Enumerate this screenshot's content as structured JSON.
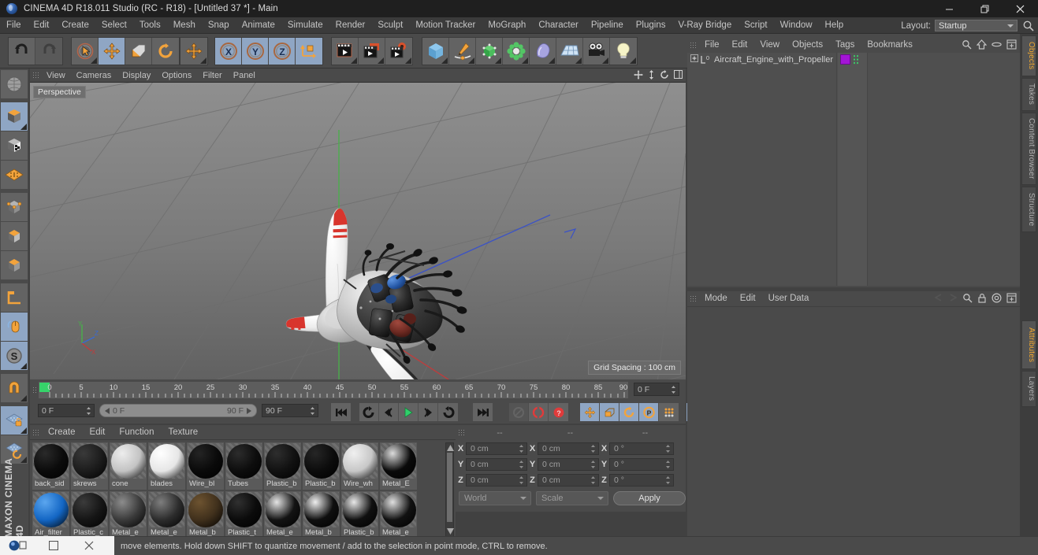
{
  "window": {
    "title": "CINEMA 4D R18.011 Studio (RC - R18) - [Untitled 37 *] - Main",
    "minimize": "minimize-button",
    "maximize": "restore-button",
    "close": "close-button"
  },
  "menubar": {
    "items": [
      "File",
      "Edit",
      "Create",
      "Select",
      "Tools",
      "Mesh",
      "Snap",
      "Animate",
      "Simulate",
      "Render",
      "Sculpt",
      "Motion Tracker",
      "MoGraph",
      "Character",
      "Pipeline",
      "Plugins",
      "V-Ray Bridge",
      "Script",
      "Window",
      "Help"
    ],
    "layout_label": "Layout:",
    "layout_value": "Startup"
  },
  "toolbar": {
    "undo": "Undo",
    "redo": "Redo",
    "select": "Live Selection",
    "move": "Move",
    "scale": "Scale",
    "rotate": "Rotate",
    "extra": "Move/Transform",
    "axis_x": "X",
    "axis_y": "Y",
    "axis_z": "Z",
    "world": "World/Object Coordinate System",
    "render_view": "Render View",
    "render_region": "Render Region / Picture Viewer",
    "render_settings": "Render Settings",
    "cube": "Add Cube Object",
    "spline": "Add Spline",
    "nurbs": "Add NURBS / Generator",
    "array": "Add Array / Modeling Object",
    "deformer": "Add Bend Deformer",
    "floor": "Add Environment / Floor",
    "camera": "Add Camera",
    "light": "Add Light"
  },
  "left_tools": [
    {
      "name": "make-editable",
      "on": false
    },
    {
      "name": "model-mode",
      "on": true
    },
    {
      "name": "texture-mode",
      "on": false
    },
    {
      "name": "polygon-uv-mode",
      "on": false
    },
    {
      "name": "points-mode",
      "on": false
    },
    {
      "name": "edges-mode",
      "on": false
    },
    {
      "name": "polygons-mode",
      "on": false
    },
    {
      "name": "axis-mode",
      "on": false
    },
    {
      "name": "viewport-solo-mode",
      "on": true
    },
    {
      "name": "enable-snap",
      "on": true
    },
    {
      "name": "workplane-magnet",
      "on": false
    },
    {
      "name": "workplane-lock",
      "on": true
    },
    {
      "name": "workplane-rotate",
      "on": false
    }
  ],
  "branding": "MAXON CINEMA 4D",
  "viewport": {
    "menu": [
      "View",
      "Cameras",
      "Display",
      "Options",
      "Filter",
      "Panel"
    ],
    "perspective_label": "Perspective",
    "grid_spacing": "Grid Spacing : 100 cm",
    "axis_labels": {
      "x": "X",
      "y": "Y",
      "z": "Z"
    }
  },
  "timeline": {
    "ticks": [
      "0",
      "5",
      "10",
      "15",
      "20",
      "25",
      "30",
      "35",
      "40",
      "45",
      "50",
      "55",
      "60",
      "65",
      "70",
      "75",
      "80",
      "85",
      "90"
    ],
    "current_frame_top": "0 F",
    "current_frame": "0 F",
    "range_start": "0 F",
    "range_end": "90 F",
    "end_frame": "90 F",
    "controls": [
      {
        "name": "go-to-start-button",
        "glyph": "first"
      },
      {
        "name": "play-backwards-button",
        "glyph": "rewind"
      },
      {
        "name": "previous-frame-button",
        "glyph": "prev"
      },
      {
        "name": "play-forwards-button",
        "glyph": "play"
      },
      {
        "name": "next-frame-button",
        "glyph": "next"
      },
      {
        "name": "play-forward-loop-button",
        "glyph": "forward"
      },
      {
        "name": "go-to-end-button",
        "glyph": "last"
      },
      {
        "name": "record-active-objects-button",
        "glyph": "record-disabled"
      },
      {
        "name": "autokeying-button",
        "glyph": "autokey"
      },
      {
        "name": "keyframe-selection-button",
        "glyph": "question"
      },
      {
        "name": "position-key-button",
        "glyph": "move"
      },
      {
        "name": "scale-key-button",
        "glyph": "scale"
      },
      {
        "name": "rotation-key-button",
        "glyph": "rotate"
      },
      {
        "name": "parameter-key-button",
        "glyph": "param"
      },
      {
        "name": "point-level-animation-button",
        "glyph": "pla"
      },
      {
        "name": "timeline-toggle-button",
        "glyph": "timeline"
      }
    ]
  },
  "materials": {
    "menu": [
      "Create",
      "Edit",
      "Function",
      "Texture"
    ],
    "row1": [
      {
        "name": "back_sid",
        "color": "#0b0b0b",
        "hl": "#2a2a2a"
      },
      {
        "name": "skrews",
        "color": "#1c1c1c",
        "hl": "#3a3a3a"
      },
      {
        "name": "cone",
        "color": "#c3c3c3",
        "hl": "#ededed"
      },
      {
        "name": "blades",
        "color": "#e6e6e6",
        "hl": "#ffffff"
      },
      {
        "name": "Wire_bl",
        "color": "#0a0a0a",
        "hl": "#242424"
      },
      {
        "name": "Tubes",
        "color": "#0d0d0d",
        "hl": "#2c2c2c"
      },
      {
        "name": "Plastic_b",
        "color": "#111111",
        "hl": "#2e2e2e"
      },
      {
        "name": "Plastic_b",
        "color": "#0c0c0c",
        "hl": "#262626"
      },
      {
        "name": "Wire_wh",
        "color": "#c7c7c7",
        "hl": "#f0f0f0"
      },
      {
        "name": "Metal_E",
        "color": "#0a0a0a",
        "hl": "#dcdcdc"
      }
    ],
    "row2": [
      {
        "name": "Air_filter",
        "color": "#1366c4",
        "hl": "#5ba6ef"
      },
      {
        "name": "Plastic_c",
        "color": "#151515",
        "hl": "#3b3b3b"
      },
      {
        "name": "Metal_e",
        "color": "#3a3a3a",
        "hl": "#8c8c8c"
      },
      {
        "name": "Metal_e",
        "color": "#2c2c2c",
        "hl": "#7e7e7e"
      },
      {
        "name": "Metal_b",
        "color": "#40301c",
        "hl": "#6d5330"
      },
      {
        "name": "Plastic_t",
        "color": "#0b0b0b",
        "hl": "#303030"
      },
      {
        "name": "Metal_e",
        "color": "#131313",
        "hl": "#e4e4e4"
      },
      {
        "name": "Metal_b",
        "color": "#0f0f0f",
        "hl": "#efefef"
      },
      {
        "name": "Plastic_b",
        "color": "#101010",
        "hl": "#e8e8e8"
      },
      {
        "name": "Metal_e",
        "color": "#111111",
        "hl": "#e0e0e0"
      }
    ]
  },
  "coordinates": {
    "headers": [
      "--",
      "--",
      "--"
    ],
    "rows": [
      {
        "axis": "X",
        "position": "0 cm",
        "size": "0 cm",
        "rotation": "0 °"
      },
      {
        "axis": "Y",
        "position": "0 cm",
        "size": "0 cm",
        "rotation": "0 °"
      },
      {
        "axis": "Z",
        "position": "0 cm",
        "size": "0 cm",
        "rotation": "0 °"
      }
    ],
    "system": "World",
    "mode": "Scale",
    "apply": "Apply"
  },
  "objects": {
    "menu": [
      "File",
      "Edit",
      "View",
      "Objects",
      "Tags",
      "Bookmarks"
    ],
    "items": [
      {
        "name": "Aircraft_Engine_with_Propeller",
        "layer_badge": "0",
        "tag_color": "#a315d6"
      }
    ]
  },
  "attributes": {
    "menu": [
      "Mode",
      "Edit",
      "User Data"
    ]
  },
  "right_tabs": [
    {
      "label": "Objects",
      "selected": true
    },
    {
      "label": "Takes",
      "selected": false
    },
    {
      "label": "Content Browser",
      "selected": false
    },
    {
      "label": "Structure",
      "selected": false
    },
    {
      "label": "Attributes",
      "selected": true
    },
    {
      "label": "Layers",
      "selected": false
    }
  ],
  "statusbar": {
    "message": "move elements. Hold down SHIFT to quantize movement / add to the selection in point mode, CTRL to remove."
  },
  "colors": {
    "accent_orange": "#f0a830",
    "panel_bg": "#4a4a4a",
    "button_bg": "#636363",
    "active_blue": "#8fa6c4",
    "highlight_green": "#36d46a",
    "tag_purple": "#a315d6"
  }
}
